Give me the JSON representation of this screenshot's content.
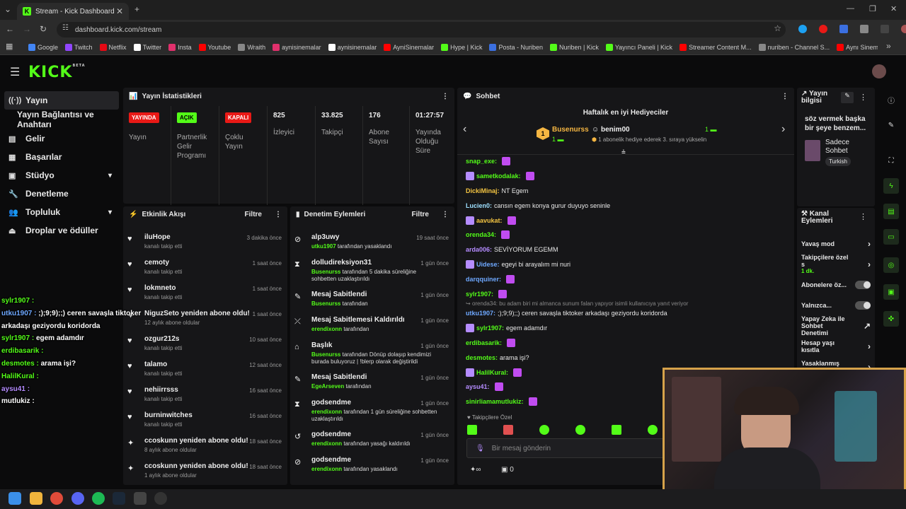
{
  "browser": {
    "tab_title": "Stream - Kick Dashboard",
    "url": "dashboard.kick.com/stream",
    "bookmarks": [
      "Google",
      "Twitch",
      "Netflix",
      "Twitter",
      "Insta",
      "Youtube",
      "Wraith",
      "aynisinemalar",
      "aynisinemalar",
      "AyniSinemalar",
      "Hype | Kick",
      "Posta - Nuriben",
      "Nuriben | Kick",
      "Yayıncı Paneli | Kick",
      "Streamer Content M...",
      "nuriben - Channel S...",
      "Aynı Sinemalar - Ça..."
    ]
  },
  "logo": "KICK",
  "logo_beta": "BETA",
  "sidebar": {
    "items": [
      {
        "label": "Yayın",
        "icon": "broadcast-icon"
      },
      {
        "label": "Yayın Bağlantısı ve Anahtarı",
        "icon": ""
      },
      {
        "label": "Gelir",
        "icon": "revenue-icon"
      },
      {
        "label": "Başarılar",
        "icon": "achievements-icon"
      },
      {
        "label": "Stüdyo",
        "icon": "studio-icon"
      },
      {
        "label": "Denetleme",
        "icon": "moderation-icon"
      },
      {
        "label": "Topluluk",
        "icon": "community-icon"
      },
      {
        "label": "Droplar ve ödüller",
        "icon": "drops-icon"
      }
    ]
  },
  "stats": {
    "title": "Yayın İstatistikleri",
    "cols": [
      {
        "badge": "YAYINDA",
        "badge_color": "#e91916",
        "label": "Yayın"
      },
      {
        "badge": "AÇIK",
        "badge_color": "#53fc18",
        "label": "Partnerlik Gelir Programı"
      },
      {
        "badge": "KAPALI",
        "badge_color": "#e91916",
        "label": "Çoklu Yayın"
      },
      {
        "value": "825",
        "label": "İzleyici"
      },
      {
        "value": "33.825",
        "label": "Takipçi"
      },
      {
        "value": "176",
        "label": "Abone Sayısı"
      },
      {
        "value": "01:27:57",
        "label": "Yayında Olduğu Süre"
      }
    ]
  },
  "activity": {
    "title": "Etkinlik Akışı",
    "filter": "Filtre",
    "events": [
      {
        "name": "iluHope",
        "desc": "kanalı takip etti",
        "time": "3 dakika önce",
        "icon": "heart-icon"
      },
      {
        "name": "cemoty",
        "desc": "kanalı takip etti",
        "time": "1 saat önce",
        "icon": "heart-icon"
      },
      {
        "name": "lokmneto",
        "desc": "kanalı takip etti",
        "time": "1 saat önce",
        "icon": "heart-icon"
      },
      {
        "name": "NiguzSeto yeniden abone oldu!",
        "desc": "12 aylık abone oldular",
        "time": "1 saat önce",
        "icon": "star-icon"
      },
      {
        "name": "ozgur212s",
        "desc": "kanalı takip etti",
        "time": "10 saat önce",
        "icon": "heart-icon"
      },
      {
        "name": "talamo",
        "desc": "kanalı takip etti",
        "time": "12 saat önce",
        "icon": "heart-icon"
      },
      {
        "name": "nehiirrsss",
        "desc": "kanalı takip etti",
        "time": "16 saat önce",
        "icon": "heart-icon"
      },
      {
        "name": "burninwitches",
        "desc": "kanalı takip etti",
        "time": "16 saat önce",
        "icon": "heart-icon"
      },
      {
        "name": "ccoskunn yeniden abone oldu!",
        "desc": "8 aylık abone oldular",
        "time": "18 saat önce",
        "icon": "star-icon"
      },
      {
        "name": "ccoskunn yeniden abone oldu!",
        "desc": "1 aylık abone oldular",
        "time": "18 saat önce",
        "icon": "star-icon"
      }
    ]
  },
  "moderation": {
    "title": "Denetim Eylemleri",
    "filter": "Filtre",
    "actions": [
      {
        "name": "alp3uwy",
        "mod": "utku1907",
        "desc": "tarafından yasaklandı",
        "time": "19 saat önce",
        "icon": "ban-icon"
      },
      {
        "name": "dolludireksiyon31",
        "mod": "Busenurss",
        "desc": "tarafından 5 dakika süreliğine sohbetten uzaklaştırıldı",
        "time": "1 gün önce",
        "icon": "hourglass-icon"
      },
      {
        "name": "Mesaj Sabitlendi",
        "mod": "Busenurss",
        "desc": "tarafından",
        "time": "1 gün önce",
        "icon": "pin-icon"
      },
      {
        "name": "Mesaj Sabitlemesi Kaldırıldı",
        "mod": "erendixonn",
        "desc": "tarafından",
        "time": "1 gün önce",
        "icon": "unpin-icon"
      },
      {
        "name": "Başlık",
        "mod": "Busenurss",
        "desc": "tarafından Dönüp dolaşıp kendimizi burada buluyoruz | !blerp olarak değiştirildi",
        "time": "1 gün önce",
        "icon": "title-icon"
      },
      {
        "name": "Mesaj Sabitlendi",
        "mod": "EgeArseven",
        "desc": "tarafından",
        "time": "1 gün önce",
        "icon": "pin-icon"
      },
      {
        "name": "godsendme",
        "mod": "erendixonn",
        "desc": "tarafından 1 gün süreliğine sohbetten uzaklaştırıldı",
        "time": "1 gün önce",
        "icon": "hourglass-icon"
      },
      {
        "name": "godsendme",
        "mod": "erendixonn",
        "desc": "tarafından yasağı kaldırıldı",
        "time": "1 gün önce",
        "icon": "unban-icon"
      },
      {
        "name": "godsendme",
        "mod": "erendixonn",
        "desc": "tarafından yasaklandı",
        "time": "1 gün önce",
        "icon": "ban-icon"
      }
    ]
  },
  "chat": {
    "title": "Sohbet",
    "gifters_title": "Haftalık en iyi Hediyeciler",
    "gifter1": {
      "rank": "1",
      "name": "Busenurss",
      "count": "1"
    },
    "gifter2": {
      "name": "benim00",
      "count": "1",
      "note": "1 abonelik hediye ederek 3. sıraya yükselin"
    },
    "messages": [
      {
        "user": "snap_exe:",
        "text": "",
        "color": "#53fc18",
        "emote": true
      },
      {
        "user": "sametkodalak:",
        "text": "",
        "color": "#53fc18",
        "emote": true
      },
      {
        "user": "DickiMinaj:",
        "text": "NT Egem",
        "color": "#f5c542",
        "emote": false
      },
      {
        "user": "Lucien0:",
        "text": "cansın egem konya gurur duyuyo seninle",
        "color": "#9ee0ff",
        "emote": false
      },
      {
        "user": "aavukat:",
        "text": "",
        "color": "#f5c542",
        "emote": true
      },
      {
        "user": "orenda34:",
        "text": "",
        "color": "#53fc18",
        "emote": true
      },
      {
        "user": "arda006:",
        "text": "SEVİYORUM EGEMM",
        "color": "#b58cff",
        "emote": false
      },
      {
        "user": "Uidese:",
        "text": "egeyi bi arayalım mi nuri",
        "color": "#6ea8ff",
        "emote": false
      },
      {
        "user": "darqquiner:",
        "text": "",
        "color": "#6ea8ff",
        "emote": true
      },
      {
        "user": "sylr1907:",
        "text": "",
        "color": "#53fc18",
        "emote": true
      }
    ],
    "reply_context": "orenda34: bu adam biri mi almanca sunum falan yapıyor isimli kullanıcıya yanıt veriyor",
    "messages2": [
      {
        "user": "utku1907:",
        "text": ";);9;9);;) ceren savaşla tiktoker arkadaşı geziyordu koridorda",
        "color": "#6ea8ff"
      },
      {
        "user": "sylr1907:",
        "text": "egem adamdır",
        "color": "#53fc18"
      },
      {
        "user": "erdibasarik:",
        "text": "",
        "color": "#53fc18"
      },
      {
        "user": "desmotes:",
        "text": "arama işi?",
        "color": "#53fc18"
      },
      {
        "user": "HalilKural:",
        "text": "",
        "color": "#53fc18"
      },
      {
        "user": "aysu41:",
        "text": "",
        "color": "#b58cff"
      },
      {
        "user": "sinirliamamutlukiz:",
        "text": "",
        "color": "#53fc18"
      }
    ],
    "followers_only": "Takipçilere Özel",
    "input_placeholder": "Bir mesaj gönderin",
    "counter": "0"
  },
  "stream_info": {
    "title": "Yayın bilgisi",
    "text": "söz vermek başka bir şeye benzem...",
    "category": "Sadece Sohbet",
    "language": "Turkish"
  },
  "channel_actions": {
    "title": "Kanal Eylemleri",
    "items": [
      {
        "label": "Yavaş mod",
        "type": "arrow"
      },
      {
        "label": "Takipçilere özel s",
        "sub": "1 dk.",
        "type": "arrow"
      },
      {
        "label": "Abonelere öz...",
        "type": "toggle"
      },
      {
        "label": "Yalnızca...",
        "type": "toggle"
      },
      {
        "label": "Yapay Zeka ile Sohbet Denetimi",
        "type": "link"
      },
      {
        "label": "Hesap yaşı kısıtla",
        "type": "arrow"
      },
      {
        "label": "Yasaklanmış kelim",
        "type": "arrow"
      }
    ]
  },
  "overlay_chat": [
    {
      "user": "sylr1907 :",
      "text": "",
      "color": "#53fc18"
    },
    {
      "user": "utku1907 :",
      "text": ";);9;9);;) ceren savaşla tiktoker",
      "color": "#6ea8ff"
    },
    {
      "user": "",
      "text": "arkadaşı geziyordu koridorda",
      "color": "#ffffff"
    },
    {
      "user": "sylr1907 :",
      "text": "egem adamdır",
      "color": "#53fc18"
    },
    {
      "user": "erdibasarik :",
      "text": "",
      "color": "#53fc18"
    },
    {
      "user": "desmotes :",
      "text": "arama işi?",
      "color": "#53fc18"
    },
    {
      "user": "HalilKural :",
      "text": "",
      "color": "#53fc18"
    },
    {
      "user": "aysu41 :",
      "text": "",
      "color": "#b58cff"
    },
    {
      "user": "mutlukiz :",
      "text": "",
      "color": "#ffffff"
    }
  ],
  "colors": {
    "accent": "#53fc18",
    "live": "#e91916",
    "panel": "#161618"
  }
}
